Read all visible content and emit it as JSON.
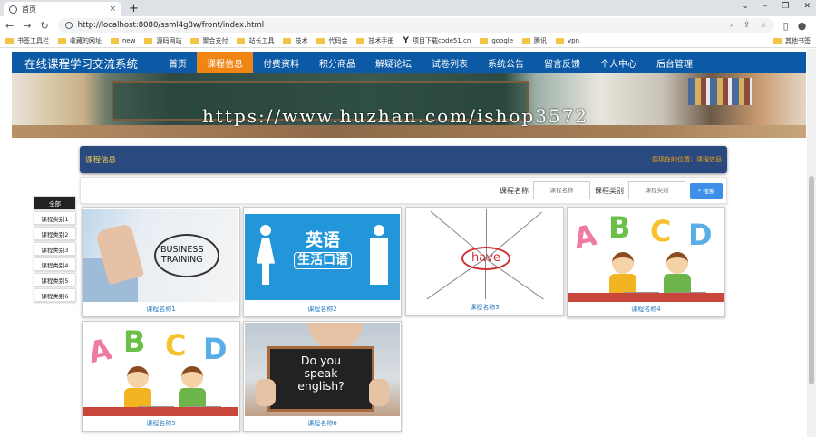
{
  "browser": {
    "tab_title": "首页",
    "tab_close": "×",
    "new_tab": "+",
    "window_controls": [
      "⌄",
      "–",
      "❐",
      "✕"
    ],
    "url": "http://localhost:8080/ssml4g8w/front/index.html",
    "nav_icons": [
      "back-icon",
      "forward-icon",
      "reload-icon"
    ],
    "omnibox_icons": [
      "zoom-icon",
      "share-icon",
      "star-icon",
      "sidepanel-icon",
      "profile-icon",
      "menu-icon"
    ],
    "bookmarks": [
      "书签工具栏",
      "收藏的网址",
      "new",
      "源码网站",
      "聚合支付",
      "站长工具",
      "技术",
      "代码会",
      "技术手册",
      "项目下载code51.cn",
      "google",
      "腾讯",
      "vpn"
    ],
    "other_bookmarks": "其他书签"
  },
  "site": {
    "brand": "在线课程学习交流系统",
    "nav": [
      "首页",
      "课程信息",
      "付费资料",
      "积分商品",
      "解疑论坛",
      "试卷列表",
      "系统公告",
      "留言反馈",
      "个人中心",
      "后台管理"
    ],
    "active_nav": "课程信息",
    "banner_watermark": "https://www.huzhan.com/ishop3572",
    "page_title": "课程信息",
    "breadcrumb": "您现在的位置：课程信息",
    "search": {
      "name_label": "课程名称",
      "name_placeholder": "课程名称",
      "type_label": "课程类别",
      "type_placeholder": "课程类别",
      "button": "搜索"
    },
    "categories": [
      "全部",
      "课程类别1",
      "课程类别2",
      "课程类别3",
      "课程类别4",
      "课程类别5",
      "课程类别6"
    ],
    "courses": [
      {
        "name": "课程名称1",
        "image_text": [
          "BUSINESS",
          "TRAINING"
        ]
      },
      {
        "name": "课程名称2",
        "image_text": [
          "英语",
          "生活口语"
        ]
      },
      {
        "name": "课程名称3",
        "image_text": [
          "have"
        ]
      },
      {
        "name": "课程名称4",
        "image_text": [
          "A",
          "B",
          "C",
          "D"
        ]
      },
      {
        "name": "课程名称5",
        "image_text": [
          "A",
          "B",
          "C",
          "D"
        ]
      },
      {
        "name": "课程名称6",
        "image_text": [
          "Do you",
          "speak",
          "english?"
        ]
      }
    ]
  },
  "colors": {
    "nav_bg": "#0c5aa6",
    "nav_active": "#f08513",
    "title_bar": "#2a4a7f",
    "title_text": "#f6d04d",
    "search_button": "#3d8fe8",
    "caption": "#2a7bbf"
  }
}
